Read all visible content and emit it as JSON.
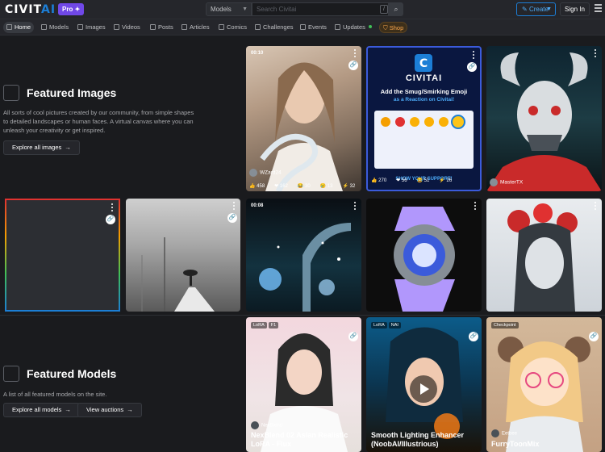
{
  "header": {
    "logo_civit": "CIVIT",
    "logo_ai": "AI",
    "pro_badge": "Pro",
    "search_type": "Models",
    "search_placeholder": "Search Civitai",
    "slash_hint": "/",
    "create_label": "Create",
    "signin_label": "Sign In"
  },
  "nav": {
    "items": [
      "Home",
      "Models",
      "Images",
      "Videos",
      "Posts",
      "Articles",
      "Comics",
      "Challenges",
      "Events",
      "Updates",
      "Shop"
    ]
  },
  "featured_images": {
    "title": "Featured Images",
    "description": "All sorts of cool pictures created by our community, from simple shapes to detailed landscapes or human faces. A virtual canvas where you can unleash your creativity or get inspired.",
    "button": "Explore all images",
    "cards": [
      {
        "time": "00:10",
        "user": "WZard24",
        "stats": [
          "458",
          "162",
          "30",
          "13",
          "32"
        ]
      },
      {
        "title_line1": "CIVITAI",
        "title_line2": "Add the Smug/Smirking Emoji",
        "title_line3": "as a Reaction on Civitai!",
        "stats": [
          "270",
          "56",
          "51",
          "26"
        ],
        "footer_text": "SHOW YOUR SUPPORT!"
      },
      {
        "user": "MasterTX"
      },
      {},
      {},
      {
        "time": "00:08"
      },
      {},
      {}
    ]
  },
  "featured_models": {
    "title": "Featured Models",
    "description": "A list of all featured models on the site.",
    "button_models": "Explore all models",
    "button_auctions": "View auctions",
    "cards": [
      {
        "tags": [
          "LoRA",
          "F1"
        ],
        "creator": "NexBlend",
        "name_line1": "NexBlend 02 Asian Realistic",
        "name_line2": "LoRA - Flux"
      },
      {
        "tags": [
          "LoRA",
          "NAI"
        ],
        "name_line1": "Smooth Lighting Enhancer",
        "name_line2": "(NoobAI/Illustrious)"
      },
      {
        "tags": [
          "Checkpoint"
        ],
        "creator": "Eetbee",
        "name_line1": "FurryToonMix"
      }
    ]
  }
}
